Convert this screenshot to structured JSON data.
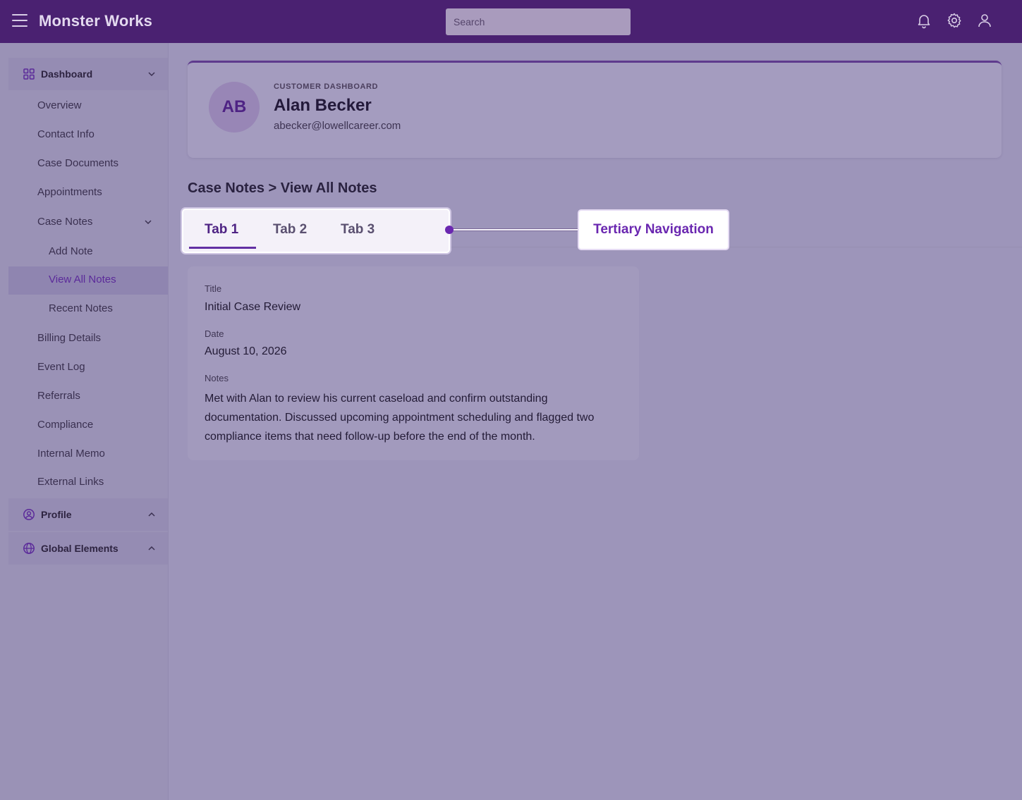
{
  "app": {
    "title": "Monster Works"
  },
  "search": {
    "placeholder": "Search"
  },
  "topbar_icons": [
    "bell-icon",
    "gear-icon",
    "user-icon"
  ],
  "sidebar": {
    "dashboard": {
      "label": "Dashboard",
      "icon": "grid-icon"
    },
    "items": [
      {
        "label": "Overview"
      },
      {
        "label": "Contact Info"
      },
      {
        "label": "Case Documents"
      },
      {
        "label": "Appointments"
      },
      {
        "label": "Case Notes"
      },
      {
        "label": "Add Note"
      },
      {
        "label": "View All Notes"
      },
      {
        "label": "Recent Notes"
      },
      {
        "label": "Billing Details"
      },
      {
        "label": "Event Log"
      },
      {
        "label": "Referrals"
      },
      {
        "label": "Compliance"
      },
      {
        "label": "Internal Memo"
      },
      {
        "label": "External Links"
      }
    ],
    "active_item": "View All Notes",
    "profile": {
      "label": "Profile",
      "icon": "user-circle-icon"
    },
    "global": {
      "label": "Global Elements",
      "icon": "globe-icon"
    }
  },
  "customer": {
    "eyebrow": "CUSTOMER DASHBOARD",
    "initials": "AB",
    "name": "Alan Becker",
    "email": "abecker@lowellcareer.com"
  },
  "breadcrumb": "Case Notes > View All Notes",
  "tabs": [
    {
      "label": "Tab 1",
      "active": true
    },
    {
      "label": "Tab 2",
      "active": false
    },
    {
      "label": "Tab 3",
      "active": false
    }
  ],
  "callout": {
    "label": "Tertiary Navigation"
  },
  "note": {
    "title_label": "Title",
    "title_value": "Initial Case Review",
    "date_label": "Date",
    "date_value": "August 10, 2026",
    "notes_label": "Notes",
    "notes_value": "Met with Alan to review his current caseload and confirm outstanding documentation. Discussed upcoming appointment scheduling and flagged two compliance items that need follow-up before the end of the month."
  },
  "colors": {
    "topbar": "#4a2171",
    "accent": "#6a27b0",
    "background": "#9d95ba"
  }
}
